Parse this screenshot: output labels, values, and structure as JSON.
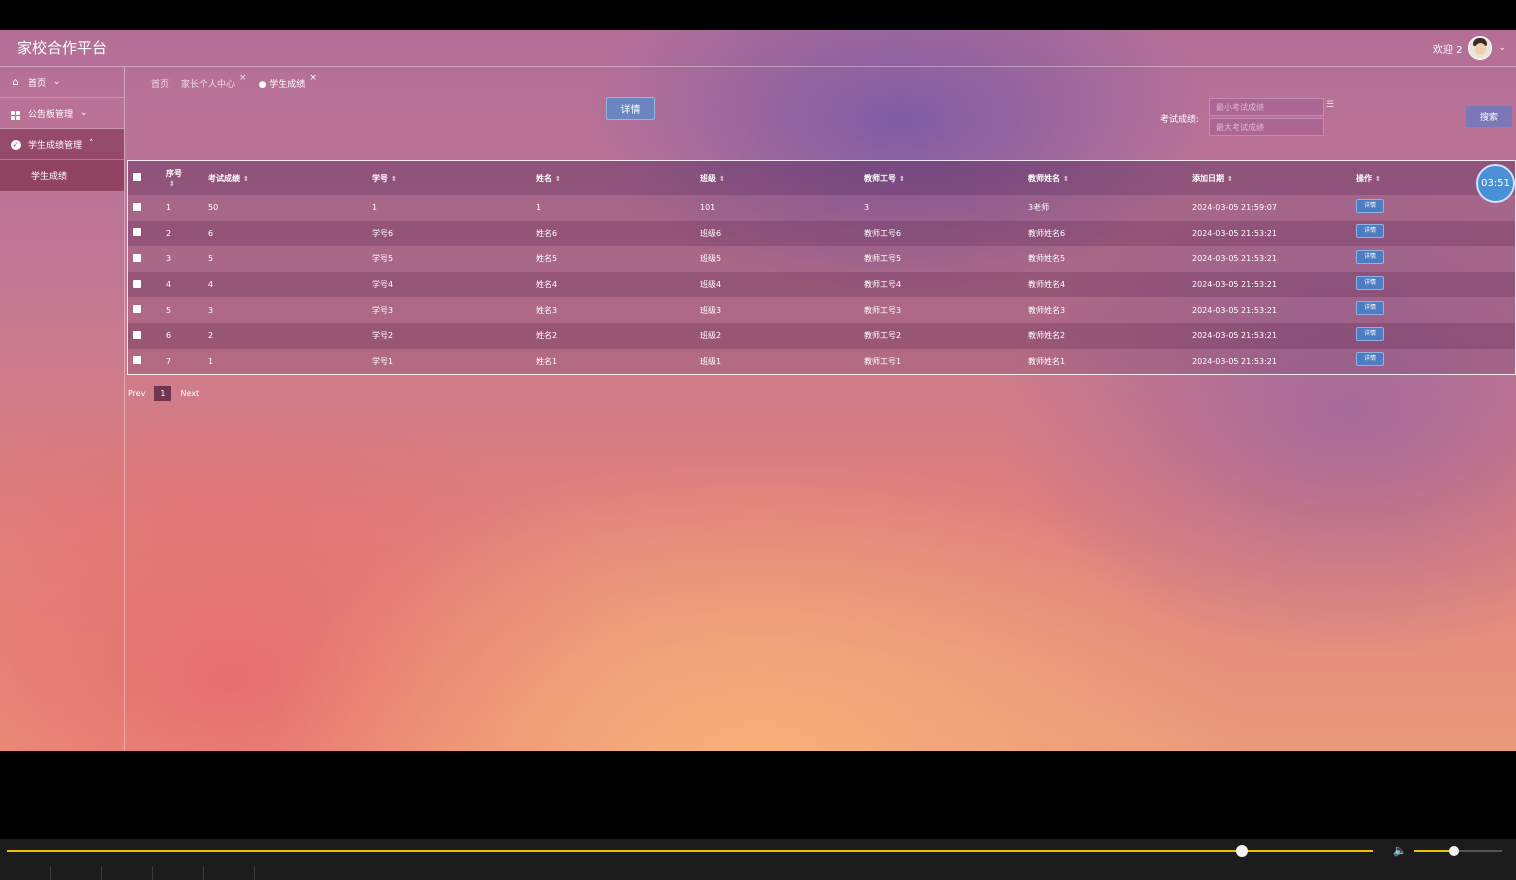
{
  "header": {
    "title": "家校合作平台",
    "welcome": "欢迎 2"
  },
  "sidebar": {
    "items": [
      {
        "label": "首页",
        "icon": "home-icon"
      },
      {
        "label": "公告板管理",
        "icon": "grid-icon"
      },
      {
        "label": "学生成绩管理",
        "icon": "check-circle-icon"
      }
    ],
    "sub_item": "学生成绩"
  },
  "breadcrumb": [
    "首页",
    "家长个人中心",
    "学生成绩"
  ],
  "toolbar": {
    "detail_label": "详情",
    "search_label": "考试成绩:",
    "min_placeholder": "最小考试成绩",
    "max_placeholder": "最大考试成绩",
    "search_button": "搜索"
  },
  "timer": "03:51",
  "table": {
    "headers": [
      "序号",
      "考试成绩",
      "学号",
      "姓名",
      "班级",
      "教师工号",
      "教师姓名",
      "添加日期",
      "操作"
    ],
    "action_label": "详情",
    "rows": [
      [
        "1",
        "50",
        "1",
        "1",
        "101",
        "3",
        "3老师",
        "2024-03-05 21:59:07"
      ],
      [
        "2",
        "6",
        "学号6",
        "姓名6",
        "班级6",
        "教师工号6",
        "教师姓名6",
        "2024-03-05 21:53:21"
      ],
      [
        "3",
        "5",
        "学号5",
        "姓名5",
        "班级5",
        "教师工号5",
        "教师姓名5",
        "2024-03-05 21:53:21"
      ],
      [
        "4",
        "4",
        "学号4",
        "姓名4",
        "班级4",
        "教师工号4",
        "教师姓名4",
        "2024-03-05 21:53:21"
      ],
      [
        "5",
        "3",
        "学号3",
        "姓名3",
        "班级3",
        "教师工号3",
        "教师姓名3",
        "2024-03-05 21:53:21"
      ],
      [
        "6",
        "2",
        "学号2",
        "姓名2",
        "班级2",
        "教师工号2",
        "教师姓名2",
        "2024-03-05 21:53:21"
      ],
      [
        "7",
        "1",
        "学号1",
        "姓名1",
        "班级1",
        "教师工号1",
        "教师姓名1",
        "2024-03-05 21:53:21"
      ]
    ]
  },
  "pagination": {
    "prev": "Prev",
    "current": "1",
    "next": "Next"
  },
  "player": {
    "seek_progress": 0.9,
    "volume": 0.45
  },
  "colors": {
    "accent_button": "#6a86c0",
    "seek": "#f0c000",
    "timer": "#4b8fd6"
  }
}
